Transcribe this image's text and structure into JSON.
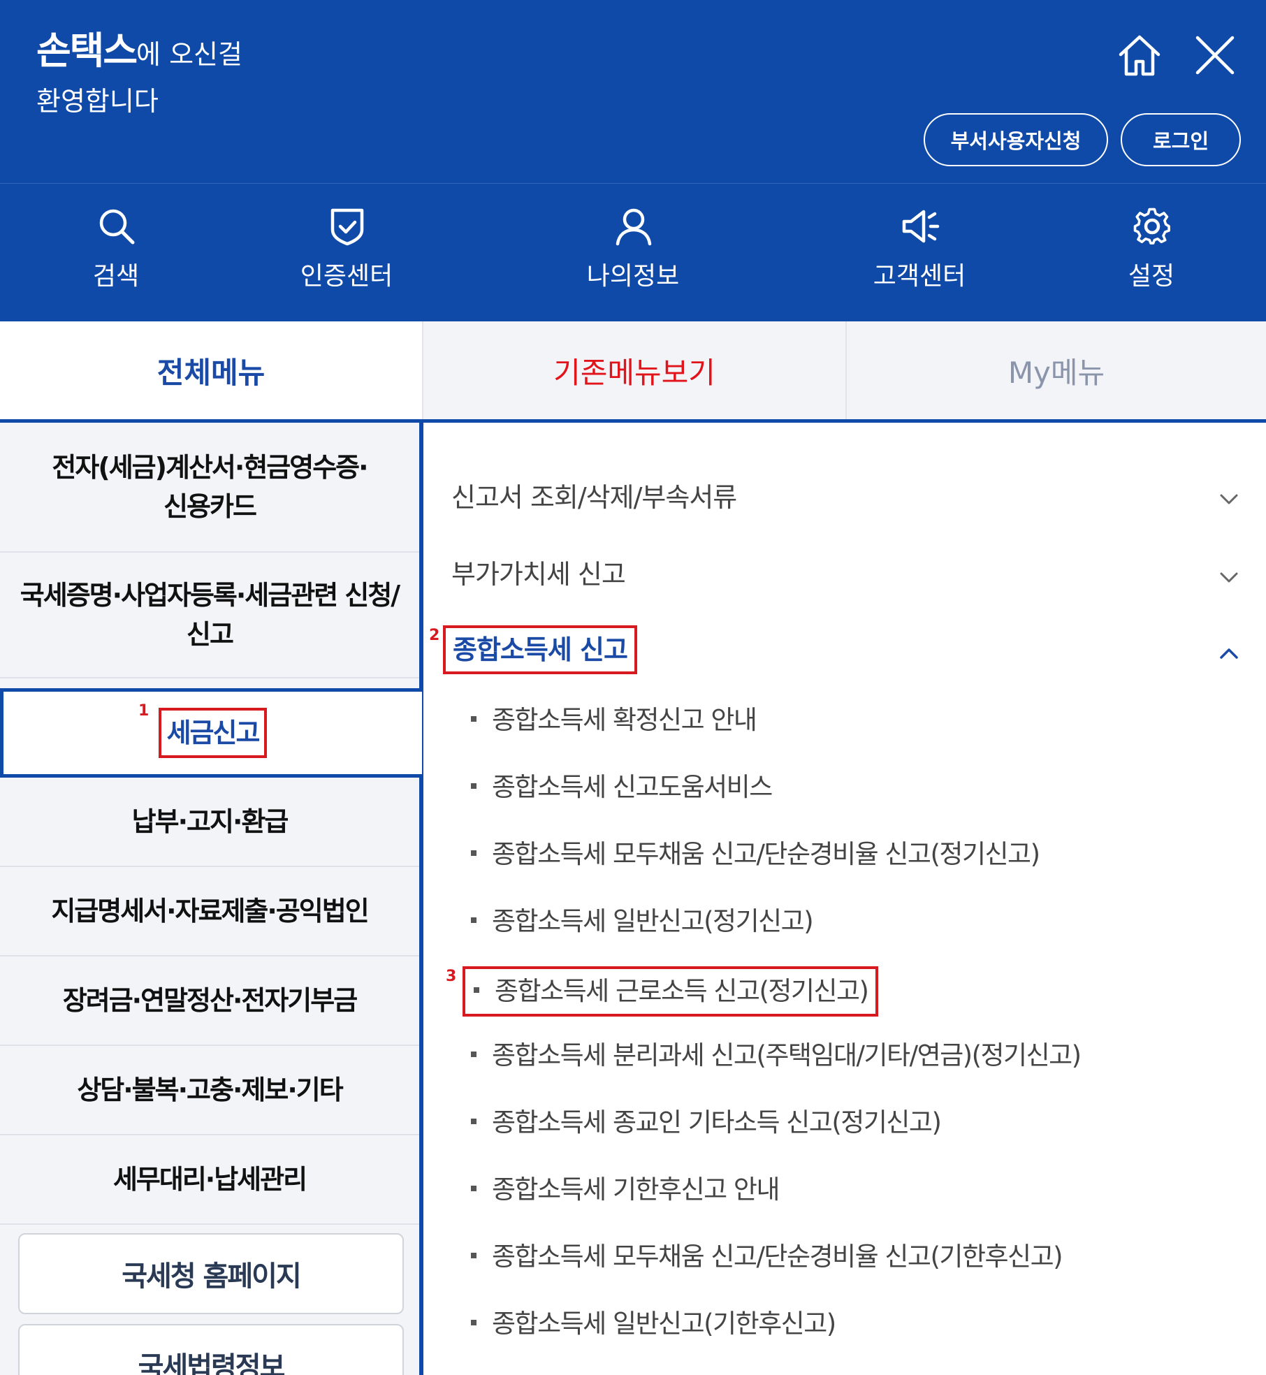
{
  "header": {
    "brand": "손택스",
    "welcome_suffix": "에 오신걸",
    "welcome_line2": "환영합니다",
    "icons": [
      "home-icon",
      "close-icon"
    ],
    "dept_user_button": "부서사용자신청",
    "login_button": "로그인",
    "bg_color": "#0f4aa8"
  },
  "quicknav": [
    {
      "label": "검색",
      "icon": "search-icon"
    },
    {
      "label": "인증센터",
      "icon": "shield-check-icon"
    },
    {
      "label": "나의정보",
      "icon": "user-icon"
    },
    {
      "label": "고객센터",
      "icon": "megaphone-icon"
    },
    {
      "label": "설정",
      "icon": "gear-icon"
    }
  ],
  "tabs": {
    "all_menu": "전체메뉴",
    "old_menu": "기존메뉴보기",
    "my_menu": "My메뉴"
  },
  "left_menu": {
    "items": [
      {
        "line1": "전자(세금)계산서·현금영수증·",
        "line2": "신용카드"
      },
      {
        "line1": "국세증명·사업자등록·세금관련 신청/",
        "line2": "신고"
      },
      {
        "line1": "세금신고",
        "line2": ""
      },
      {
        "line1": "납부·고지·환급",
        "line2": ""
      },
      {
        "line1": "지급명세서·자료제출·공익법인",
        "line2": ""
      },
      {
        "line1": "장려금·연말정산·전자기부금",
        "line2": ""
      },
      {
        "line1": "상담·불복·고충·제보·기타",
        "line2": ""
      },
      {
        "line1": "세무대리·납세관리",
        "line2": ""
      }
    ],
    "buttons": [
      "국세청 홈페이지",
      "국세법령정보"
    ],
    "active_index": 2
  },
  "annotations": {
    "a1": "1",
    "a2": "2",
    "a3": "3"
  },
  "right_menu": {
    "sections": [
      {
        "label": "신고서 조회/삭제/부속서류",
        "state": "collapsed"
      },
      {
        "label": "부가가치세 신고",
        "state": "collapsed"
      },
      {
        "label": "종합소득세 신고",
        "state": "expanded"
      }
    ],
    "sub_items": [
      "종합소득세 확정신고 안내",
      "종합소득세 신고도움서비스",
      "종합소득세 모두채움 신고/단순경비율 신고(정기신고)",
      "종합소득세 일반신고(정기신고)",
      "종합소득세 근로소득 신고(정기신고)",
      "종합소득세 분리과세 신고(주택임대/기타/연금)(정기신고)",
      "종합소득세 종교인 기타소득 신고(정기신고)",
      "종합소득세 기한후신고 안내",
      "종합소득세 모두채움 신고/단순경비율 신고(기한후신고)",
      "종합소득세 일반신고(기한후신고)"
    ],
    "highlight_color": "#d71920"
  }
}
